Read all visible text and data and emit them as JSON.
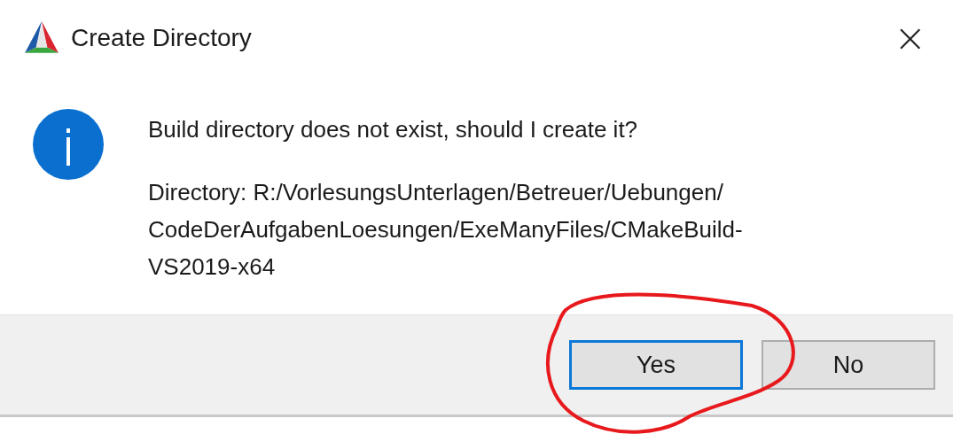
{
  "window": {
    "title": "Create Directory",
    "close": "×"
  },
  "message": {
    "question": "Build directory does not exist, should I create it?",
    "detail_lines": [
      "Directory: R:/VorlesungsUnterlagen/Betreuer/Uebungen/",
      "CodeDerAufgabenLoesungen/ExeManyFiles/CMakeBuild-",
      "VS2019-x64"
    ]
  },
  "buttons": [
    {
      "label": "Yes",
      "selected": true
    },
    {
      "label": "No",
      "selected": false
    }
  ]
}
